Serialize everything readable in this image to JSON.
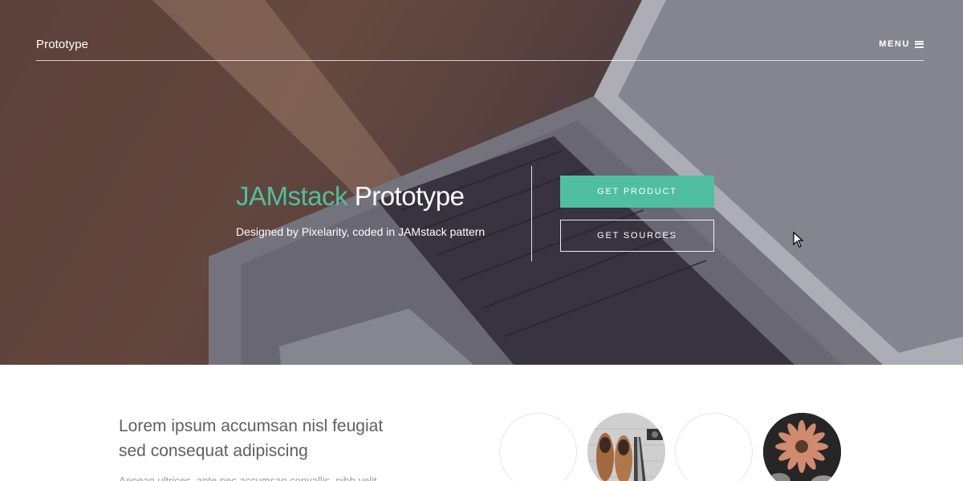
{
  "nav": {
    "brand": "Prototype",
    "menu_label": "MENU"
  },
  "hero": {
    "title_accent": "JAMstack",
    "title_rest": "Prototype",
    "subtitle": "Designed by Pixelarity, coded in JAMstack pattern",
    "primary_button": "GET PRODUCT",
    "secondary_button": "GET SOURCES"
  },
  "section": {
    "heading": "Lorem ipsum accumsan nisl feugiat sed consequat adipiscing",
    "body_text": "Aenean ultrices, ante nec accumsan convallis, nibh velit"
  },
  "colors": {
    "accent": "#4fbf9f",
    "text_dark": "#5f6063"
  },
  "icons": {
    "menu": "hamburger-icon",
    "cursor": "mouse-pointer"
  }
}
